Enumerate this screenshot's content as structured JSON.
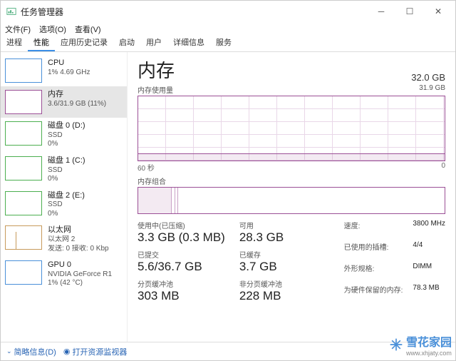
{
  "window": {
    "title": "任务管理器"
  },
  "menubar": [
    "文件(F)",
    "选项(O)",
    "查看(V)"
  ],
  "tabs": [
    "进程",
    "性能",
    "应用历史记录",
    "启动",
    "用户",
    "详细信息",
    "服务"
  ],
  "active_tab": 1,
  "sidebar": [
    {
      "title": "CPU",
      "sub1": "1%  4.69 GHz",
      "sub2": "",
      "kind": "cpu"
    },
    {
      "title": "内存",
      "sub1": "3.6/31.9 GB (11%)",
      "sub2": "",
      "kind": "mem",
      "selected": true
    },
    {
      "title": "磁盘 0 (D:)",
      "sub1": "SSD",
      "sub2": "0%",
      "kind": "disk"
    },
    {
      "title": "磁盘 1 (C:)",
      "sub1": "SSD",
      "sub2": "0%",
      "kind": "disk"
    },
    {
      "title": "磁盘 2 (E:)",
      "sub1": "SSD",
      "sub2": "0%",
      "kind": "disk"
    },
    {
      "title": "以太网",
      "sub1": "以太网 2",
      "sub2": "发送: 0 接收: 0 Kbp",
      "kind": "eth"
    },
    {
      "title": "GPU 0",
      "sub1": "NVIDIA GeForce R1",
      "sub2": "1%  (42 °C)",
      "kind": "gpu"
    }
  ],
  "main": {
    "title": "内存",
    "total": "32.0 GB",
    "usage_label": "内存使用量",
    "usage_max": "31.9 GB",
    "axis_left": "60 秒",
    "axis_right": "0",
    "comp_label": "内存组合",
    "stats": {
      "in_use_label": "使用中(已压缩)",
      "in_use_value": "3.3 GB (0.3 MB)",
      "available_label": "可用",
      "available_value": "28.3 GB",
      "committed_label": "已提交",
      "committed_value": "5.6/36.7 GB",
      "cached_label": "已缓存",
      "cached_value": "3.7 GB",
      "paged_label": "分页缓冲池",
      "paged_value": "303 MB",
      "nonpaged_label": "非分页缓冲池",
      "nonpaged_value": "228 MB"
    },
    "specs": {
      "speed_label": "速度:",
      "speed_value": "3800 MHz",
      "slots_label": "已使用的插槽:",
      "slots_value": "4/4",
      "form_label": "外形规格:",
      "form_value": "DIMM",
      "reserved_label": "为硬件保留的内存:",
      "reserved_value": "78.3 MB"
    }
  },
  "footer": {
    "brief": "简略信息(D)",
    "resmon": "打开资源监视器"
  },
  "watermark": {
    "text": "雪花家园",
    "url": "www.xhjaty.com"
  },
  "chart_data": {
    "type": "area",
    "title": "内存使用量",
    "x_range_seconds": [
      60,
      0
    ],
    "y_range_gb": [
      0,
      31.9
    ],
    "series": [
      {
        "name": "内存使用量 (GB)",
        "approx_constant_value": 3.6
      }
    ],
    "composition": [
      {
        "name": "使用中",
        "value_gb": 3.3
      },
      {
        "name": "已压缩",
        "value_mb": 0.3
      },
      {
        "name": "可用",
        "value_gb": 28.3
      }
    ]
  }
}
